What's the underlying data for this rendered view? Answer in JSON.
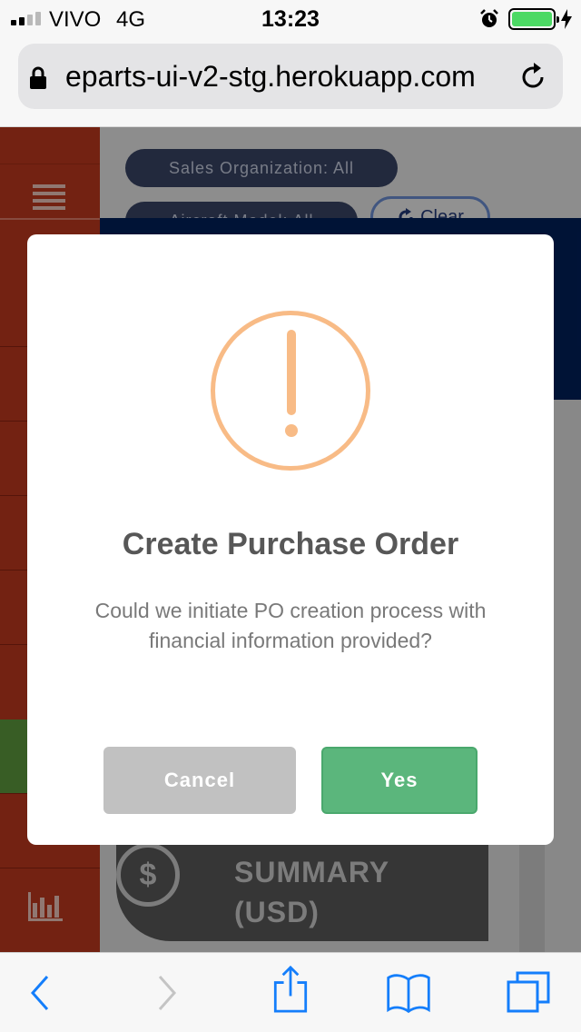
{
  "status_bar": {
    "carrier": "VIVO",
    "network": "4G",
    "time": "13:23",
    "battery_color": "#4cd964"
  },
  "browser": {
    "url": "eparts-ui-v2-stg.herokuapp.com"
  },
  "page": {
    "filters": {
      "sales_organization": "Sales Organization: All",
      "aircraft_model": "Aircraft Model: All",
      "clear_label": "Clear"
    },
    "summary": {
      "label": "SUMMARY (USD)",
      "icon": "dollar-icon"
    },
    "colors": {
      "sidebar": "#c0391e",
      "banner": "#00205b",
      "sidebar_active": "#5e9b3e"
    }
  },
  "dialog": {
    "icon": "warning-icon",
    "icon_color": "#f8bb86",
    "title": "Create Purchase Order",
    "message": "Could we initiate PO creation process with financial information provided?",
    "cancel_label": "Cancel",
    "confirm_label": "Yes",
    "confirm_color": "#5bb67c",
    "cancel_color": "#c1c1c1"
  },
  "toolbar": {
    "icons": [
      "back-icon",
      "forward-icon",
      "share-icon",
      "bookmarks-icon",
      "tabs-icon"
    ]
  }
}
